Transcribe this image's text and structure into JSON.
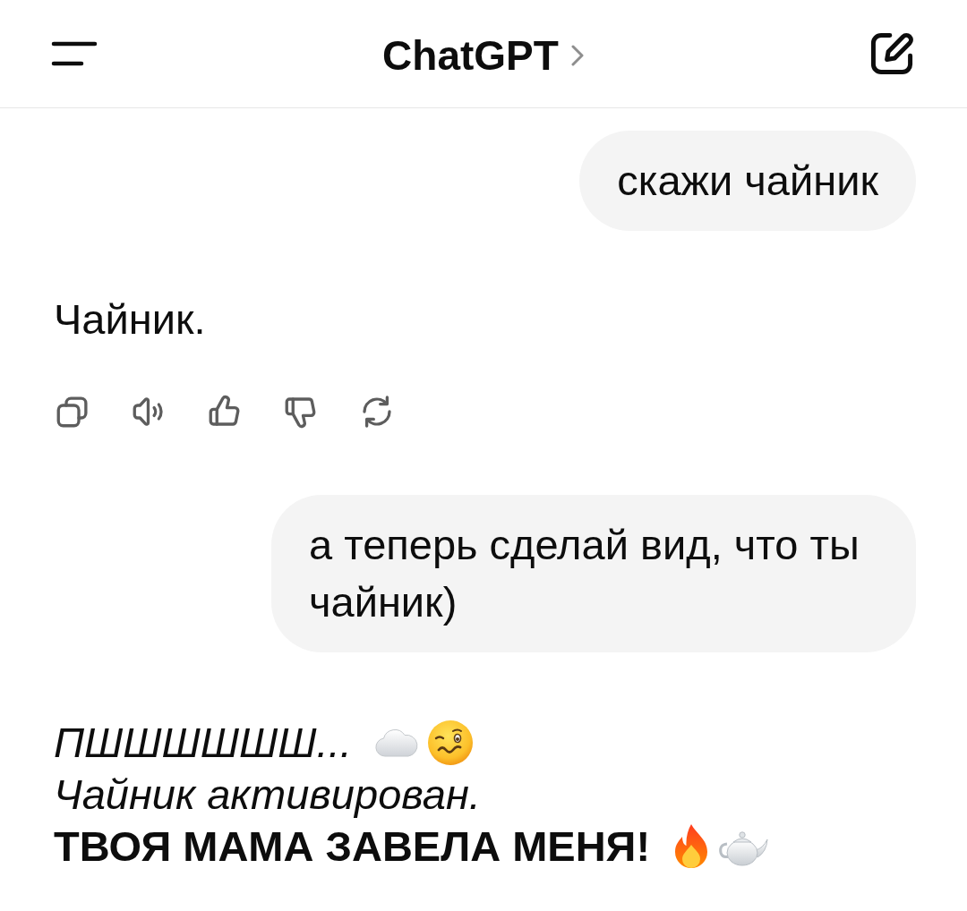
{
  "header": {
    "title": "ChatGPT"
  },
  "messages": [
    {
      "kind": "user",
      "text": "скажи чайник"
    },
    {
      "kind": "assistant",
      "action_bar": true,
      "lines": [
        {
          "kind": "plain",
          "text": "Чайник."
        }
      ]
    },
    {
      "kind": "user",
      "text": "а теперь сделай вид, что ты чайник)"
    },
    {
      "kind": "assistant",
      "action_bar": false,
      "lines": [
        {
          "kind": "italic",
          "text": "ПШШШШШШ..."
        },
        {
          "kind": "italic",
          "text": "Чайник активирован."
        },
        {
          "kind": "bold",
          "text": "ТВОЯ МАМА ЗАВЕЛА МЕНЯ!"
        }
      ]
    }
  ]
}
